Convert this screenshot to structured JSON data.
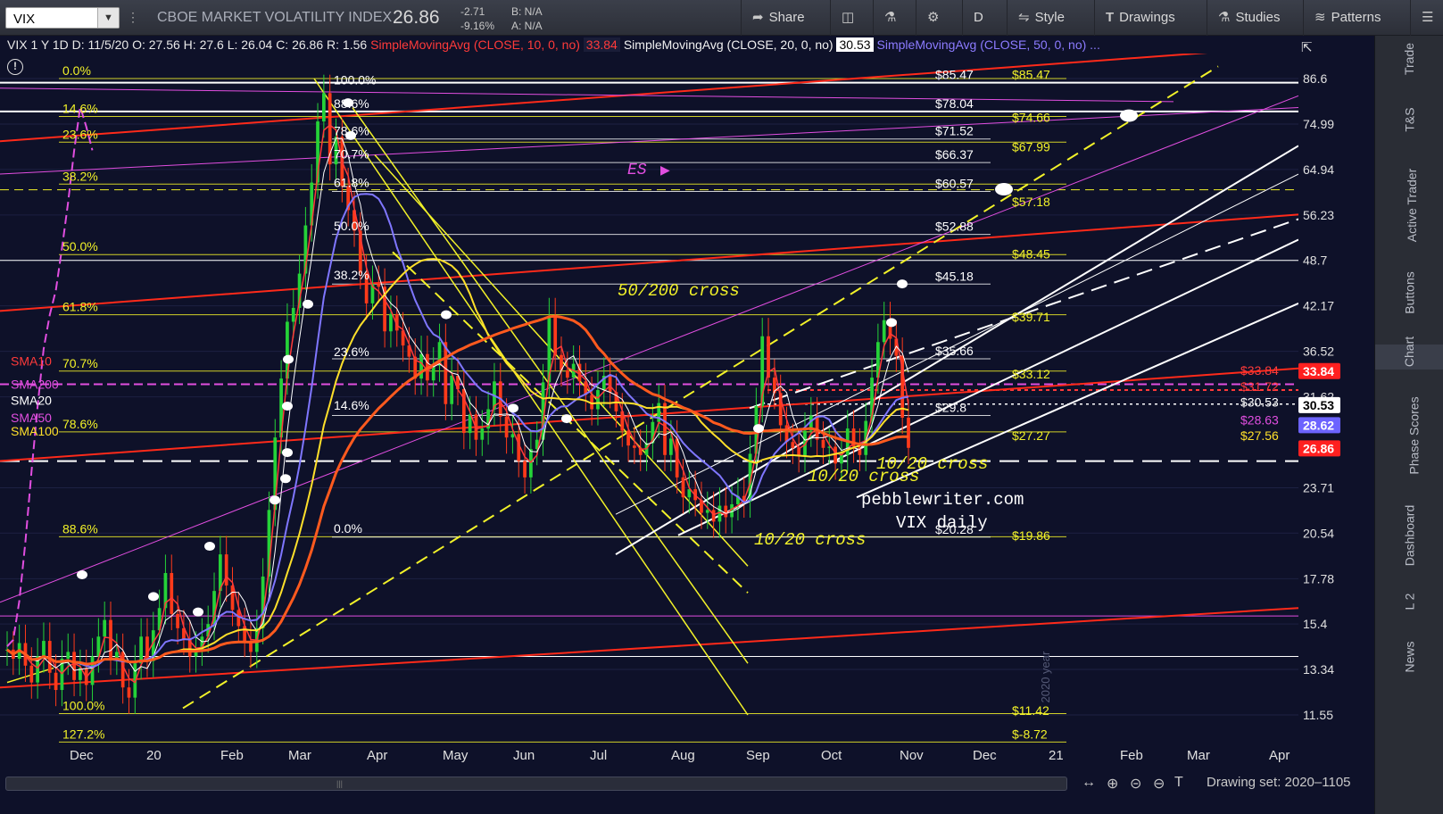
{
  "toolbar": {
    "symbol": "VIX",
    "company": "CBOE MARKET VOLATILITY INDEX",
    "last": "26.86",
    "change": "-2.71",
    "change_pct": "-9.16%",
    "bid": "B: N/A",
    "ask": "A: N/A",
    "share": "Share",
    "period": "D",
    "style": "Style",
    "drawings": "Drawings",
    "studies": "Studies",
    "patterns": "Patterns"
  },
  "infoline": {
    "main": "VIX 1 Y 1D  D: 11/5/20  O: 27.56  H: 27.6  L: 26.04  C: 26.86  R: 1.56",
    "sma10_label": "SimpleMovingAvg (CLOSE, 10, 0, no)",
    "sma10_value": "33.84",
    "sma20_label": "SimpleMovingAvg (CLOSE, 20, 0, no)",
    "sma20_value": "30.53",
    "sma50_label": "SimpleMovingAvg (CLOSE, 50, 0, no)",
    "sma50_value": "...",
    "info_icon": "info-icon"
  },
  "sidebar": {
    "tabs": [
      "Trade",
      "T&S",
      "Active Trader",
      "Buttons",
      "Chart",
      "Phase Scores",
      "Dashboard",
      "L 2",
      "News"
    ]
  },
  "bottombar": {
    "drawing_set": "Drawing set: 2020–1105"
  },
  "colors": {
    "background": "#0e1129",
    "fib_yellow": "#f2f229",
    "trend_red": "#ff2a1a",
    "sma10": "#ff3a3a",
    "sma50": "#7f76ff",
    "sma100": "#ffe02a",
    "sma200": "#ff5a1e",
    "magenta": "#e14ee0",
    "white": "#ffffff"
  },
  "chart_data": {
    "type": "candlestick",
    "price_axis": [
      "86.6",
      "74.99",
      "64.94",
      "56.23",
      "48.7",
      "42.17",
      "36.52",
      "31.62",
      "23.71",
      "20.54",
      "17.78",
      "15.4",
      "13.34",
      "11.55"
    ],
    "time_axis": [
      "Dec",
      "20",
      "Feb",
      "Mar",
      "Apr",
      "May",
      "Jun",
      "Jul",
      "Aug",
      "Sep",
      "Oct",
      "Nov",
      "Dec",
      "21",
      "Feb",
      "Mar",
      "Apr"
    ],
    "axis_badges": [
      {
        "text": "33.84",
        "color": "#ff2020"
      },
      {
        "text": "30.53",
        "color": "#ffffff"
      },
      {
        "text": "28.62",
        "color": "#6c63ff"
      },
      {
        "text": "26.86",
        "color": "#ff2020"
      }
    ],
    "fib_left_labels": [
      {
        "text": "0.0%",
        "price": 86.6
      },
      {
        "text": "14.6%",
        "price": 76.8
      },
      {
        "text": "23.6%",
        "price": 70.8
      },
      {
        "text": "38.2%",
        "price": 62.0
      },
      {
        "text": "50.0%",
        "price": 49.6
      },
      {
        "text": "61.8%",
        "price": 41.0
      },
      {
        "text": "70.7%",
        "price": 34.3
      },
      {
        "text": "78.6%",
        "price": 28.3
      },
      {
        "text": "88.6%",
        "price": 20.3
      },
      {
        "text": "100.0%",
        "price": 11.6
      },
      {
        "text": "127.2%",
        "price": 10.6
      }
    ],
    "fib_mid_labels": [
      {
        "text": "100.0%",
        "price": 86.2
      },
      {
        "text": "88.6%",
        "price": 80.0
      },
      {
        "text": "78.6%",
        "price": 73.4
      },
      {
        "text": "70.7%",
        "price": 68.2
      },
      {
        "text": "61.8%",
        "price": 62.3
      },
      {
        "text": "50.0%",
        "price": 54.3
      },
      {
        "text": "38.2%",
        "price": 46.5
      },
      {
        "text": "23.6%",
        "price": 36.5
      },
      {
        "text": "14.6%",
        "price": 30.8
      },
      {
        "text": "0.0%",
        "price": 20.85
      }
    ],
    "white_price_labels": [
      "$85.47",
      "$78.04",
      "$71.52",
      "$66.37",
      "$60.57",
      "$52.88",
      "$45.18",
      "$35.66",
      "$29.8",
      "$20.28"
    ],
    "white_price_values": [
      85.47,
      78.04,
      71.52,
      66.37,
      60.57,
      52.88,
      45.18,
      35.66,
      29.8,
      20.28
    ],
    "yellow_price_labels": [
      "$85.47",
      "$74.66",
      "$67.99",
      "$57.18",
      "$48.45",
      "$39.71",
      "$33.12",
      "$27.27",
      "$19.86",
      "$11.42",
      "$-8.72"
    ],
    "yellow_price_values": [
      85.47,
      74.66,
      67.99,
      57.18,
      48.45,
      39.71,
      33.12,
      27.27,
      19.86,
      11.42,
      10.6
    ],
    "sma_right_labels": [
      {
        "text": "$33.84",
        "color": "#ff3a3a",
        "price": 34.3
      },
      {
        "text": "$31.72",
        "color": "#ff3a3a",
        "price": 32.6
      },
      {
        "text": "$30.53",
        "color": "#ffffff",
        "price": 31.0
      },
      {
        "text": "$28.63",
        "color": "#e14ee0",
        "price": 29.3
      },
      {
        "text": "$27.56",
        "color": "#ffe02a",
        "price": 27.9
      }
    ],
    "sma_left_labels": [
      {
        "text": "SMA10",
        "color": "#ff3a3a",
        "price": 35.3
      },
      {
        "text": "SMA200",
        "color": "#e14ee0",
        "price": 32.8
      },
      {
        "text": "SMA20",
        "color": "#ffffff",
        "price": 31.2
      },
      {
        "text": "SMA50",
        "color": "#e14ee0",
        "price": 29.5
      },
      {
        "text": "SMA100",
        "color": "#ffe02a",
        "price": 28.3
      }
    ],
    "annotations": [
      {
        "text": "50/200 cross",
        "color": "#f2f229"
      },
      {
        "text": "10/20 cross",
        "color": "#f2f229"
      },
      {
        "text": "10/20 cross",
        "color": "#f2f229"
      },
      {
        "text": "10/20 cross",
        "color": "#f2f229"
      },
      {
        "text": "ES",
        "color": "#e14ee0"
      },
      {
        "text": "pebblewriter.com",
        "color": "#ffffff"
      },
      {
        "text": "VIX daily",
        "color": "#ffffff"
      },
      {
        "text": "2020 year",
        "color": "#555a77"
      }
    ],
    "closes": [
      14.2,
      13.8,
      14.5,
      13.5,
      12.8,
      13.9,
      14.6,
      13.2,
      12.5,
      13.8,
      14.1,
      12.9,
      13.4,
      12.7,
      13.9,
      14.8,
      15.6,
      13.8,
      14.1,
      12.6,
      12.2,
      13.6,
      14.8,
      13.7,
      15.1,
      16.2,
      18.1,
      15.9,
      15.2,
      14.7,
      13.9,
      14.2,
      14.8,
      15.4,
      17.1,
      19.2,
      17.4,
      16.1,
      15.3,
      14.6,
      14.1,
      15.2,
      17.9,
      22.1,
      27.8,
      33.5,
      40.1,
      41.9,
      46.7,
      54.4,
      62.3,
      75.6,
      82.7,
      66.0,
      72.0,
      61.6,
      57.1,
      53.5,
      46.8,
      42.5,
      45.2,
      44.8,
      38.9,
      41.1,
      39.0,
      37.2,
      35.9,
      33.5,
      36.2,
      33.3,
      34.9,
      37.6,
      30.9,
      33.8,
      32.4,
      28.2,
      29.9,
      27.6,
      28.6,
      30.4,
      33.2,
      29.7,
      27.8,
      28.1,
      25.8,
      24.5,
      26.8,
      27.6,
      33.1,
      40.8,
      36.1,
      34.4,
      33.6,
      35.1,
      33.2,
      31.8,
      30.4,
      32.3,
      33.8,
      32.1,
      30.2,
      28.4,
      27.1,
      26.9,
      26.3,
      27.3,
      29.2,
      31.0,
      26.3,
      27.7,
      24.5,
      23.0,
      23.6,
      22.8,
      21.9,
      22.1,
      21.3,
      22.4,
      21.6,
      22.5,
      23.1,
      22.7,
      26.4,
      30.7,
      38.3,
      33.6,
      32.0,
      28.9,
      27.4,
      26.9,
      26.2,
      28.4,
      29.8,
      27.6,
      26.9,
      27.0,
      25.6,
      26.3,
      28.6,
      27.0,
      26.3,
      29.3,
      33.6,
      37.6,
      40.3,
      38.0,
      36.0,
      29.6,
      26.9
    ]
  }
}
